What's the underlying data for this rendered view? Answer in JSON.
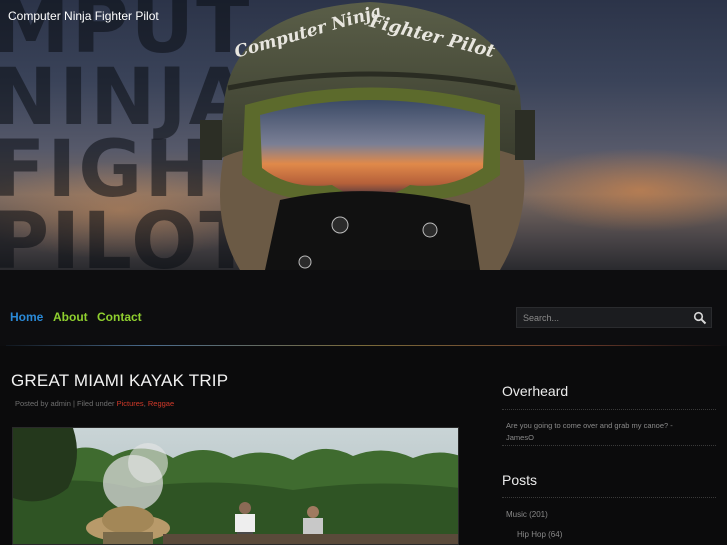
{
  "header": {
    "site_title": "Computer Ninja Fighter Pilot",
    "bg_letters": [
      "MPUT",
      "NINJA",
      "FIGHTE",
      "PILOT"
    ],
    "helmet_text_left": "Computer Ninja",
    "helmet_text_right": "Fighter Pilot"
  },
  "nav": {
    "items": [
      "Home",
      "About",
      "Contact"
    ],
    "search_placeholder": "Search...",
    "colors": {
      "active": "#2a8ad8",
      "link": "#8fcf2f"
    }
  },
  "post": {
    "title": "GREAT MIAMI KAYAK TRIP",
    "meta_prefix": "Posted by admin | Filed under ",
    "categories": [
      "Pictures",
      "Reggae"
    ],
    "category_color": "#d23a2a"
  },
  "sidebar": {
    "overheard": {
      "title": "Overheard",
      "quote": "Are you going to come over and grab my canoe? -",
      "author": "JamesO"
    },
    "posts": {
      "title": "Posts",
      "categories": [
        {
          "label": "Music (201)"
        },
        {
          "label": "Hip Hop (64)"
        }
      ]
    }
  }
}
